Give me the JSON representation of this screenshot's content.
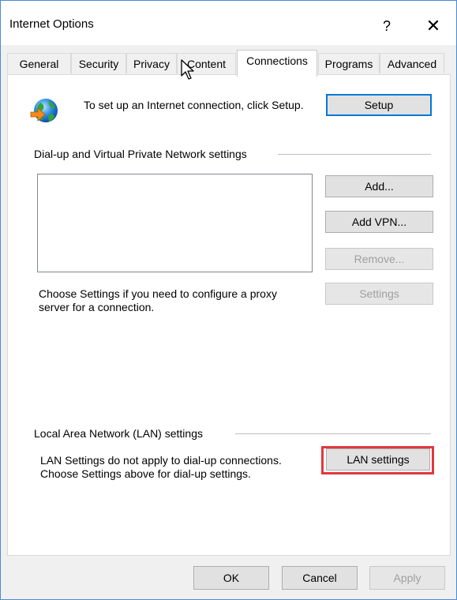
{
  "window": {
    "title": "Internet Options",
    "help_glyph": "?",
    "close_glyph": "✕"
  },
  "tabs": [
    {
      "label": "General"
    },
    {
      "label": "Security"
    },
    {
      "label": "Privacy"
    },
    {
      "label": "Content"
    },
    {
      "label": "Connections",
      "active": true
    },
    {
      "label": "Programs"
    },
    {
      "label": "Advanced"
    }
  ],
  "connections": {
    "setup_text": "To set up an Internet connection, click Setup.",
    "setup_button": "Setup",
    "dialup_group_label": "Dial-up and Virtual Private Network settings",
    "add_button": "Add...",
    "add_vpn_button": "Add VPN...",
    "remove_button": "Remove...",
    "settings_button": "Settings",
    "proxy_text": "Choose Settings if you need to configure a proxy server for a connection.",
    "lan_group_label": "Local Area Network (LAN) settings",
    "lan_text": "LAN Settings do not apply to dial-up connections. Choose Settings above for dial-up settings.",
    "lan_settings_button": "LAN settings"
  },
  "footer": {
    "ok_button": "OK",
    "cancel_button": "Cancel",
    "apply_button": "Apply"
  },
  "colors": {
    "accent": "#0078d7",
    "highlight": "#e0383e"
  }
}
